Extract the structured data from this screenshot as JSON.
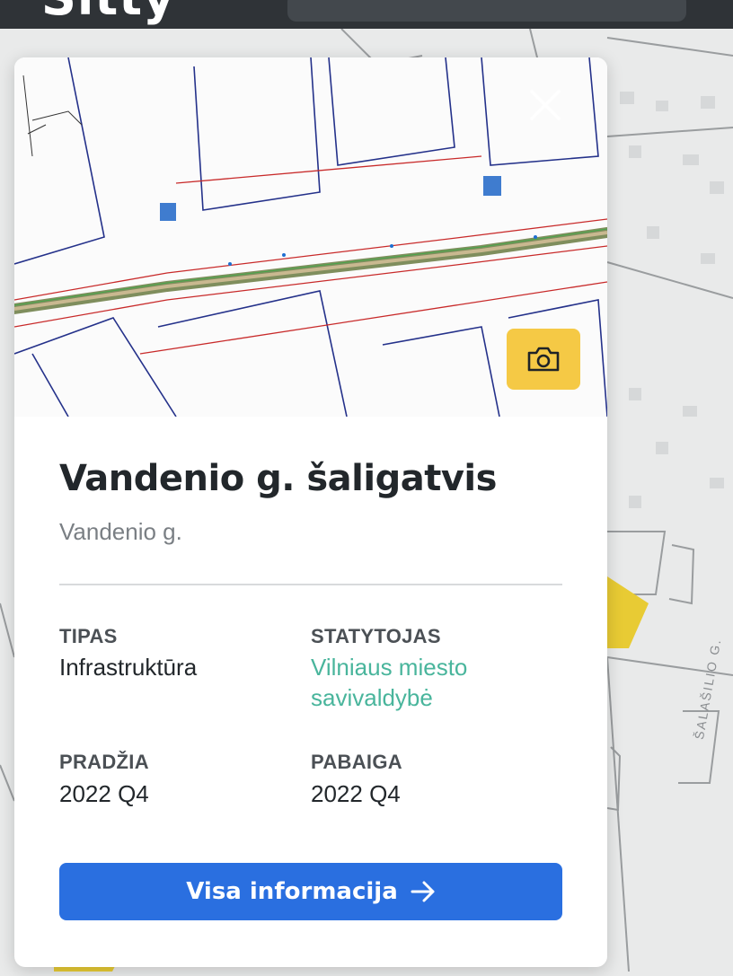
{
  "app": {
    "logo_text": "Sitty"
  },
  "map": {
    "street_label": "ŠALAŠILIO G."
  },
  "card": {
    "title": "Vandenio g. šaligatvis",
    "subtitle": "Vandenio g.",
    "fields": [
      {
        "label": "TIPAS",
        "value": "Infrastruktūra"
      },
      {
        "label": "STATYTOJAS",
        "value": "Vilniaus miesto savivaldybė"
      },
      {
        "label": "PRADŽIA",
        "value": "2022 Q4"
      },
      {
        "label": "PABAIGA",
        "value": "2022 Q4"
      }
    ],
    "cta_label": "Visa informacija",
    "icons": {
      "close": "close-icon",
      "camera": "camera-icon",
      "cta": "arrow-right-icon"
    },
    "colors": {
      "accent": "#2a6fe0",
      "link": "#49b59c",
      "camera_button": "#f5c945"
    }
  }
}
